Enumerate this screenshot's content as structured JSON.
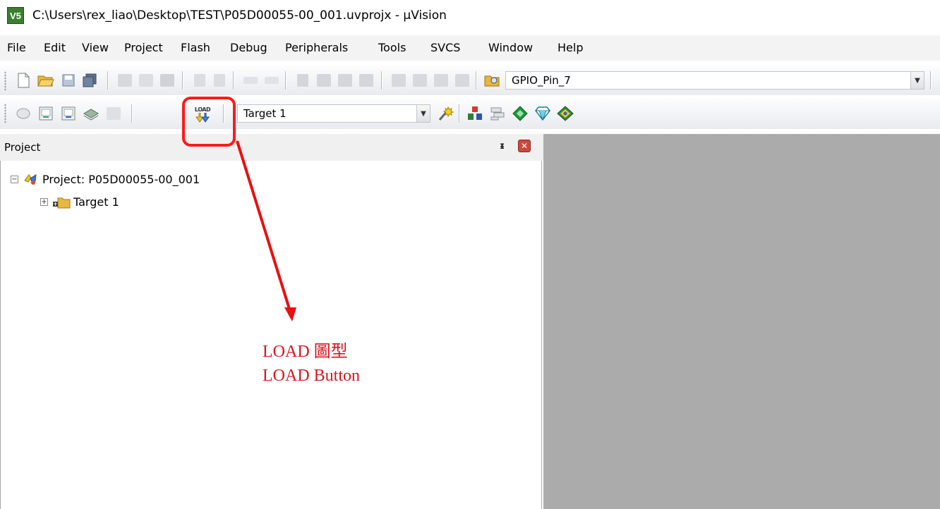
{
  "window": {
    "title": "C:\\Users\\rex_liao\\Desktop\\TEST\\P05D00055-00_001.uvprojx - µVision",
    "app_icon_text": "V5"
  },
  "menu": [
    "File",
    "Edit",
    "View",
    "Project",
    "Flash",
    "Debug",
    "Peripherals",
    "Tools",
    "SVCS",
    "Window",
    "Help"
  ],
  "toolbar1": {
    "find_value": "GPIO_Pin_7",
    "icons": [
      "new-file-icon",
      "open-file-icon",
      "save-icon",
      "save-all-icon",
      "cut-icon",
      "copy-icon",
      "paste-icon",
      "undo-icon",
      "redo-icon",
      "navigate-back-icon",
      "navigate-forward-icon",
      "bookmark-icon",
      "prev-bookmark-icon",
      "next-bookmark-icon",
      "clear-bookmarks-icon",
      "indent-icon",
      "unindent-icon",
      "comment-icon",
      "uncomment-icon",
      "find-in-files-icon"
    ]
  },
  "toolbar2": {
    "load_icon_text": "LOAD",
    "target_value": "Target 1",
    "icons": [
      "translate-icon",
      "build-icon",
      "rebuild-icon",
      "batch-build-icon",
      "stop-build-icon",
      "download-load-icon",
      "target-options-icon",
      "manage-components-icon",
      "file-extensions-icon",
      "select-packs-icon",
      "pack-installer-icon",
      "run-time-environment-icon"
    ]
  },
  "project_panel": {
    "title": "Project",
    "pin_icon": "pin-icon",
    "close_icon": "close-icon",
    "tree": [
      {
        "label": "Project: P05D00055-00_001",
        "expander": "−",
        "icon": "project-icon"
      },
      {
        "label": "Target 1",
        "expander": "+",
        "icon": "target-folder-icon"
      }
    ]
  },
  "annotation": {
    "line1": "LOAD  圖型",
    "line2": "LOAD Button",
    "color": "#e01010"
  }
}
